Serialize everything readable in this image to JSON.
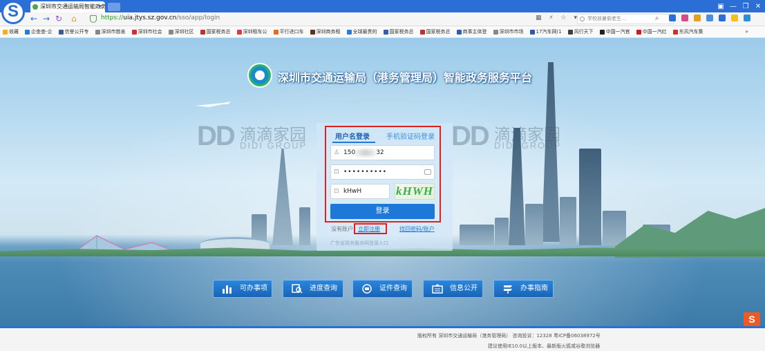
{
  "browser": {
    "tab_title": "深圳市交通运输局智能政务...",
    "tab_close": "×",
    "url_protocol": "https://",
    "url_host": "uia.jtys.sz.gov.cn",
    "url_path": "/sso/app/login",
    "search_placeholder": "学校放暑假老生...",
    "window_controls": [
      "▣",
      "—",
      "❐",
      "✕"
    ],
    "nav_icons": [
      "back-icon",
      "forward-icon",
      "refresh-icon",
      "home-icon"
    ]
  },
  "bookmarks": {
    "items": [
      "收藏",
      "企查查-企",
      "信誉公开专",
      "深圳市慈善",
      "深圳市社会",
      "深圳社区",
      "国家税务总",
      "深圳租车公",
      "平行进口车",
      "深圳商务租",
      "全球最贵的",
      "国家税务总",
      "国家税务总",
      "商事主体登",
      "深圳市市场",
      "17汽车网(1",
      "风行天下",
      "中国一汽官",
      "中国一汽红",
      "东风汽车集"
    ],
    "more": "»"
  },
  "page": {
    "title": "深圳市交通运输局（港务管理局）智能政务服务平台",
    "watermark": {
      "logo": "DD",
      "cn": "滴滴家园",
      "en": "DIDI GROUP"
    }
  },
  "login": {
    "tab_username": "用户名登录",
    "tab_phone": "手机验证码登录",
    "username_prefix": "150",
    "username_suffix": "32",
    "password_mask": "••••••••••",
    "captcha_input": "kHwH",
    "captcha_image_text": "kHWH",
    "submit": "登录",
    "no_account": "没有账户",
    "register": "立即注册",
    "recover": "找回密码/账户",
    "gd_login": "广东省政务服务网登录入口"
  },
  "services": [
    {
      "label": "可办事项",
      "icon": "bar-chart-icon"
    },
    {
      "label": "进度查询",
      "icon": "search-progress-icon"
    },
    {
      "label": "证件查询",
      "icon": "certificate-icon"
    },
    {
      "label": "信息公开",
      "icon": "info-icon"
    },
    {
      "label": "办事指南",
      "icon": "guide-icon"
    }
  ],
  "footer": {
    "line1": "版权所有  深圳市交通运输局（港务管理局）  咨询投诉：12328  粤ICP备06038972号",
    "line2": "建议使用IE10.0以上版本、最新版火狐或谷歌浏览器"
  },
  "ime_badge": "S",
  "colors": {
    "brand": "#2b6fd6",
    "primary_button": "#1e78d8",
    "highlight": "#e02020"
  }
}
